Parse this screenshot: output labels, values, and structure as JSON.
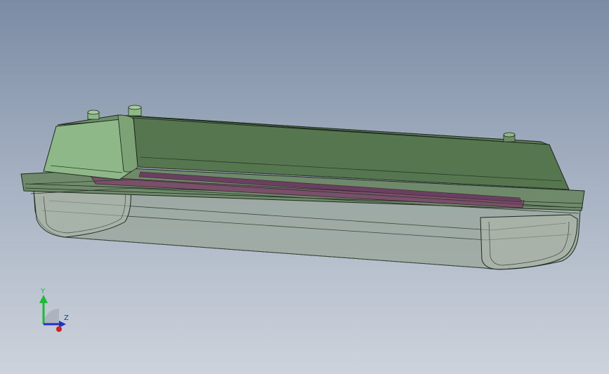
{
  "viewport": {
    "background_top": "#7b8ba4",
    "background_bottom": "#cdd3dc"
  },
  "model": {
    "housing_color": "#5a7a56",
    "housing_light_color": "#8fb888",
    "diffuser_color": "#9aa69a",
    "gasket_color": "#7a4f6a",
    "edge_color": "#1e2a1e"
  },
  "triad": {
    "y_label": "Y",
    "z_label": "Z",
    "y_color": "#1fb83a",
    "x_color": "#d42020",
    "z_color": "#2030c8"
  }
}
